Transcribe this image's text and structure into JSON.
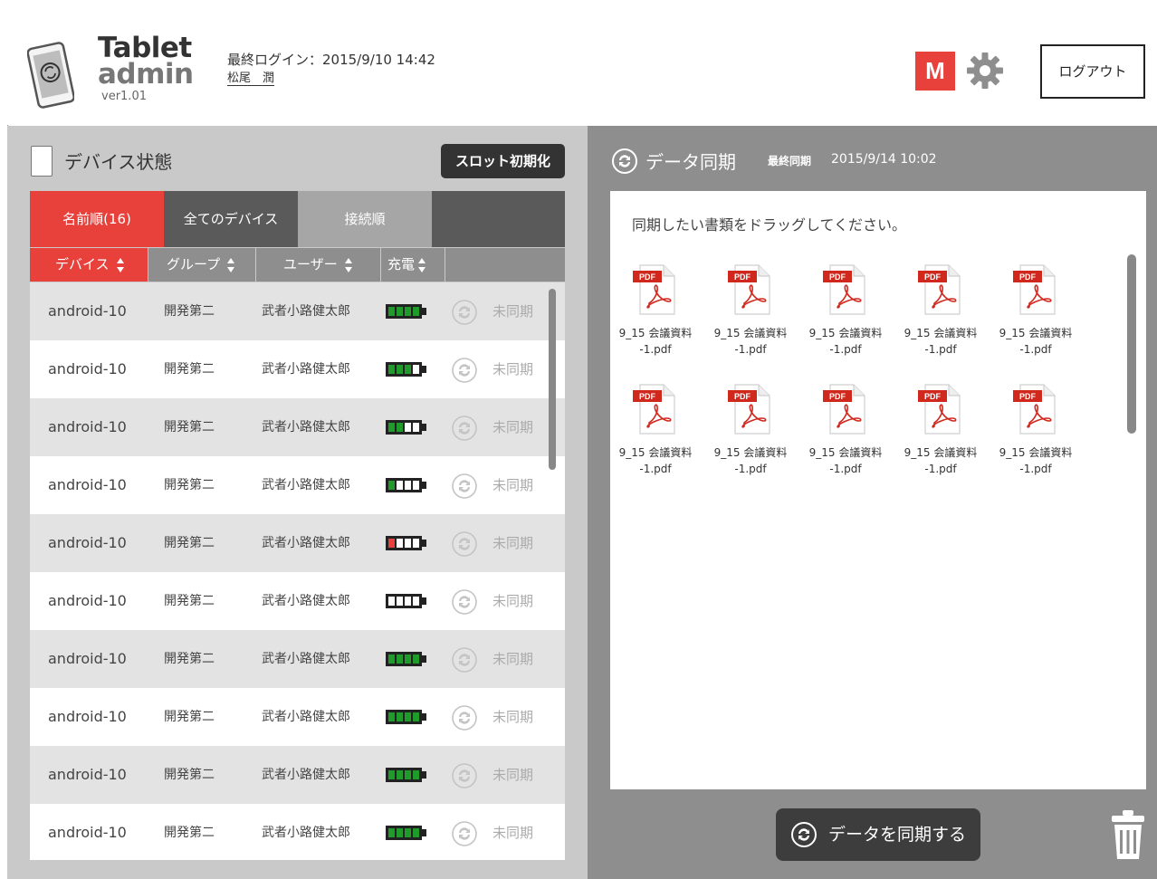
{
  "header": {
    "app_title_line1": "Tablet",
    "app_title_line2": "admin",
    "version": "ver1.01",
    "last_login": "最終ログイン：2015/9/10 14:42",
    "user_name": "松尾　潤",
    "m_label": "M",
    "logout_label": "ログアウト"
  },
  "left": {
    "title": "デバイス状態",
    "slot_reset_label": "スロット初期化",
    "tabs": [
      {
        "label": "名前順(16)"
      },
      {
        "label": "全てのデバイス"
      },
      {
        "label": "接続順"
      }
    ],
    "columns": [
      {
        "label": "デバイス"
      },
      {
        "label": "グループ"
      },
      {
        "label": "ユーザー"
      },
      {
        "label": "充電"
      }
    ],
    "rows": [
      {
        "device": "android-10",
        "group": "開発第二",
        "user": "武者小路健太郎",
        "battery": 1.0,
        "status": "未同期"
      },
      {
        "device": "android-10",
        "group": "開発第二",
        "user": "武者小路健太郎",
        "battery": 0.75,
        "status": "未同期"
      },
      {
        "device": "android-10",
        "group": "開発第二",
        "user": "武者小路健太郎",
        "battery": 0.5,
        "status": "未同期"
      },
      {
        "device": "android-10",
        "group": "開発第二",
        "user": "武者小路健太郎",
        "battery": 0.25,
        "status": "未同期"
      },
      {
        "device": "android-10",
        "group": "開発第二",
        "user": "武者小路健太郎",
        "battery": 0.1,
        "status": "未同期"
      },
      {
        "device": "android-10",
        "group": "開発第二",
        "user": "武者小路健太郎",
        "battery": 0.0,
        "status": "未同期"
      },
      {
        "device": "android-10",
        "group": "開発第二",
        "user": "武者小路健太郎",
        "battery": 1.0,
        "status": "未同期"
      },
      {
        "device": "android-10",
        "group": "開発第二",
        "user": "武者小路健太郎",
        "battery": 1.0,
        "status": "未同期"
      },
      {
        "device": "android-10",
        "group": "開発第二",
        "user": "武者小路健太郎",
        "battery": 1.0,
        "status": "未同期"
      },
      {
        "device": "android-10",
        "group": "開発第二",
        "user": "武者小路健太郎",
        "battery": 1.0,
        "status": "未同期"
      }
    ]
  },
  "right": {
    "title": "データ同期",
    "last_sync_label": "最終同期",
    "last_sync_value": "2015/9/14 10:02",
    "drop_hint": "同期したい書類をドラッグしてください。",
    "files": [
      {
        "line1": "9_15 会議資料",
        "line2": "-1.pdf"
      },
      {
        "line1": "9_15 会議資料",
        "line2": "-1.pdf"
      },
      {
        "line1": "9_15 会議資料",
        "line2": "-1.pdf"
      },
      {
        "line1": "9_15 会議資料",
        "line2": "-1.pdf"
      },
      {
        "line1": "9_15 会議資料",
        "line2": "-1.pdf"
      },
      {
        "line1": "9_15 会議資料",
        "line2": "-1.pdf"
      },
      {
        "line1": "9_15 会議資料",
        "line2": "-1.pdf"
      },
      {
        "line1": "9_15 会議資料",
        "line2": "-1.pdf"
      },
      {
        "line1": "9_15 会議資料",
        "line2": "-1.pdf"
      },
      {
        "line1": "9_15 会議資料",
        "line2": "-1.pdf"
      }
    ],
    "pdf_badge": "PDF",
    "sync_button_label": "データを同期する"
  },
  "colors": {
    "accent": "#e8413c",
    "battery_green": "#1f9a2b",
    "battery_low": "#e8413c"
  },
  "icons": [
    "tablet-logo-icon",
    "gear-icon",
    "sync-icon",
    "pdf-file-icon",
    "trash-icon",
    "battery-icon",
    "sort-icon"
  ]
}
